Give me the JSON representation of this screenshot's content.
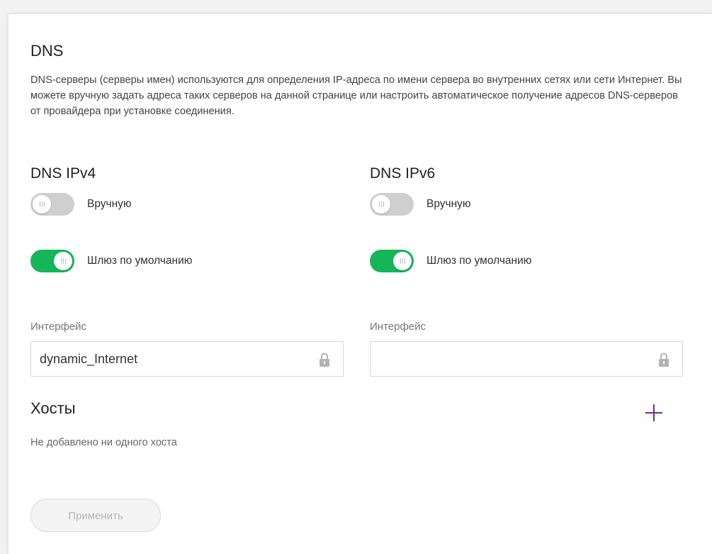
{
  "page": {
    "title": "DNS",
    "description": "DNS-серверы (серверы имен) используются для определения IP-адреса по имени сервера во внутренних сетях или сети Интернет. Вы можете вручную задать адреса таких серверов на данной странице или настроить автоматическое получение адресов DNS-серверов от провайдера при установке соединения."
  },
  "ipv4": {
    "title": "DNS IPv4",
    "manual": {
      "label": "Вручную",
      "enabled": false
    },
    "gateway": {
      "label": "Шлюз по умолчанию",
      "enabled": true
    },
    "interface": {
      "label": "Интерфейс",
      "value": "dynamic_Internet",
      "locked": true,
      "icon": "lock-icon"
    }
  },
  "ipv6": {
    "title": "DNS IPv6",
    "manual": {
      "label": "Вручную",
      "enabled": false
    },
    "gateway": {
      "label": "Шлюз по умолчанию",
      "enabled": true
    },
    "interface": {
      "label": "Интерфейс",
      "value": "",
      "locked": true,
      "icon": "lock-icon"
    }
  },
  "hosts": {
    "title": "Хосты",
    "empty_text": "Не добавлено ни одного хоста",
    "add_icon": "plus-icon"
  },
  "actions": {
    "apply_label": "Применить",
    "apply_disabled": true
  },
  "colors": {
    "toggle_on": "#15b65a",
    "toggle_off": "#cfcfcf",
    "accent_plus": "#7b2a8c",
    "background": "#f2f2f2"
  }
}
